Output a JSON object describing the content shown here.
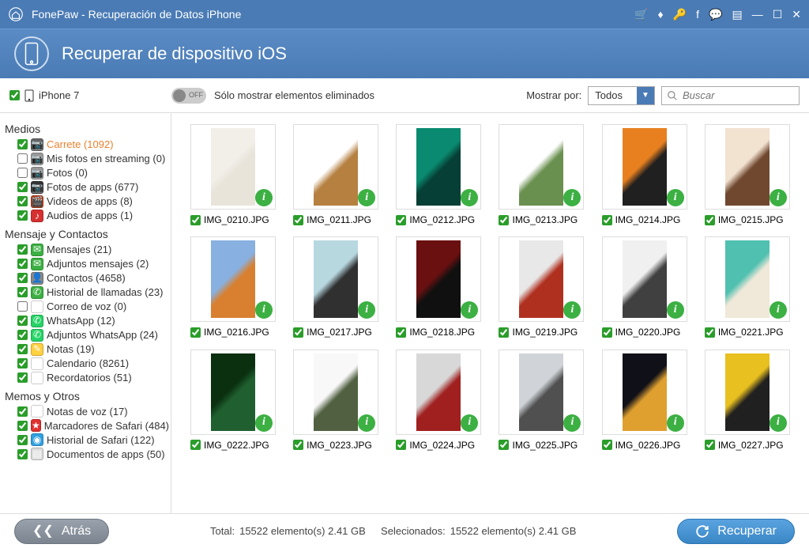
{
  "titlebar": {
    "title": "FonePaw - Recuperación de Datos iPhone"
  },
  "header": {
    "title": "Recuperar de dispositivo iOS"
  },
  "toolbar": {
    "device": "iPhone 7",
    "toggle_off": "OFF",
    "toggle_label": "Sólo mostrar elementos eliminados",
    "show_by": "Mostrar por:",
    "dropdown_value": "Todos",
    "search_placeholder": "Buscar"
  },
  "sidebar": {
    "groups": [
      {
        "title": "Medios",
        "items": [
          {
            "label": "Carrete (1092)",
            "active": true,
            "checked": true,
            "ico": "cam",
            "bg": "#666"
          },
          {
            "label": "Mis fotos en streaming (0)",
            "checked": false,
            "disabled": true,
            "ico": "cam",
            "bg": "#999"
          },
          {
            "label": "Fotos (0)",
            "checked": false,
            "disabled": true,
            "ico": "cam",
            "bg": "#999"
          },
          {
            "label": "Fotos de apps (677)",
            "checked": true,
            "ico": "cam",
            "bg": "#333"
          },
          {
            "label": "Videos de apps (8)",
            "checked": true,
            "ico": "vid",
            "bg": "#b04020"
          },
          {
            "label": "Audios de apps (1)",
            "checked": true,
            "ico": "aud",
            "bg": "#d63030"
          }
        ]
      },
      {
        "title": "Mensaje y Contactos",
        "items": [
          {
            "label": "Mensajes (21)",
            "checked": true,
            "ico": "msg",
            "bg": "#3cb043"
          },
          {
            "label": "Adjuntos mensajes (2)",
            "checked": true,
            "ico": "msg",
            "bg": "#3cb043"
          },
          {
            "label": "Contactos (4658)",
            "checked": true,
            "ico": "con",
            "bg": "#888"
          },
          {
            "label": "Historial de llamadas (23)",
            "checked": true,
            "ico": "call",
            "bg": "#3cb043"
          },
          {
            "label": "Correo de voz (0)",
            "checked": false,
            "disabled": true,
            "ico": "vm",
            "bg": "#fff"
          },
          {
            "label": "WhatsApp (12)",
            "checked": true,
            "ico": "wa",
            "bg": "#25d366"
          },
          {
            "label": "Adjuntos WhatsApp (24)",
            "checked": true,
            "ico": "wa",
            "bg": "#25d366"
          },
          {
            "label": "Notas (19)",
            "checked": true,
            "ico": "note",
            "bg": "#ffd040"
          },
          {
            "label": "Calendario (8261)",
            "checked": true,
            "ico": "cal",
            "bg": "#fff"
          },
          {
            "label": "Recordatorios (51)",
            "checked": true,
            "ico": "rem",
            "bg": "#fff"
          }
        ]
      },
      {
        "title": "Memos y Otros",
        "items": [
          {
            "label": "Notas de voz (17)",
            "checked": true,
            "ico": "mic",
            "bg": "#fff"
          },
          {
            "label": "Marcadores de Safari (484)",
            "checked": true,
            "ico": "bm",
            "bg": "#e03030"
          },
          {
            "label": "Historial de Safari (122)",
            "checked": true,
            "ico": "saf",
            "bg": "#30a0e0"
          },
          {
            "label": "Documentos de apps (50)",
            "checked": true,
            "ico": "doc",
            "bg": "#ddd"
          }
        ]
      }
    ]
  },
  "grid": [
    {
      "name": "IMG_0210.JPG",
      "c1": "#f2efe9",
      "c2": "#e8e4da"
    },
    {
      "name": "IMG_0211.JPG",
      "c1": "#ffffff",
      "c2": "#b58040"
    },
    {
      "name": "IMG_0212.JPG",
      "c1": "#0a8a70",
      "c2": "#063f35"
    },
    {
      "name": "IMG_0213.JPG",
      "c1": "#ffffff",
      "c2": "#6a9050"
    },
    {
      "name": "IMG_0214.JPG",
      "c1": "#e88020",
      "c2": "#202020"
    },
    {
      "name": "IMG_0215.JPG",
      "c1": "#f2e2d0",
      "c2": "#704830"
    },
    {
      "name": "IMG_0216.JPG",
      "c1": "#88b0e0",
      "c2": "#d88030"
    },
    {
      "name": "IMG_0217.JPG",
      "c1": "#b8d8e0",
      "c2": "#303030"
    },
    {
      "name": "IMG_0218.JPG",
      "c1": "#6a1010",
      "c2": "#101010"
    },
    {
      "name": "IMG_0219.JPG",
      "c1": "#e8e8e8",
      "c2": "#b03020"
    },
    {
      "name": "IMG_0220.JPG",
      "c1": "#f0f0f0",
      "c2": "#404040"
    },
    {
      "name": "IMG_0221.JPG",
      "c1": "#50c0b0",
      "c2": "#f0e8d8"
    },
    {
      "name": "IMG_0222.JPG",
      "c1": "#0a3010",
      "c2": "#206030"
    },
    {
      "name": "IMG_0223.JPG",
      "c1": "#f8f8f8",
      "c2": "#506040"
    },
    {
      "name": "IMG_0224.JPG",
      "c1": "#d8d8d8",
      "c2": "#a02020"
    },
    {
      "name": "IMG_0225.JPG",
      "c1": "#d0d4d8",
      "c2": "#505050"
    },
    {
      "name": "IMG_0226.JPG",
      "c1": "#101018",
      "c2": "#e0a030"
    },
    {
      "name": "IMG_0227.JPG",
      "c1": "#e8c020",
      "c2": "#202020"
    }
  ],
  "footer": {
    "back": "Atrás",
    "total_label": "Total:",
    "total_value": "15522 elemento(s) 2.41 GB",
    "sel_label": "Selecionados:",
    "sel_value": "15522 elemento(s) 2.41 GB",
    "recover": "Recuperar"
  }
}
